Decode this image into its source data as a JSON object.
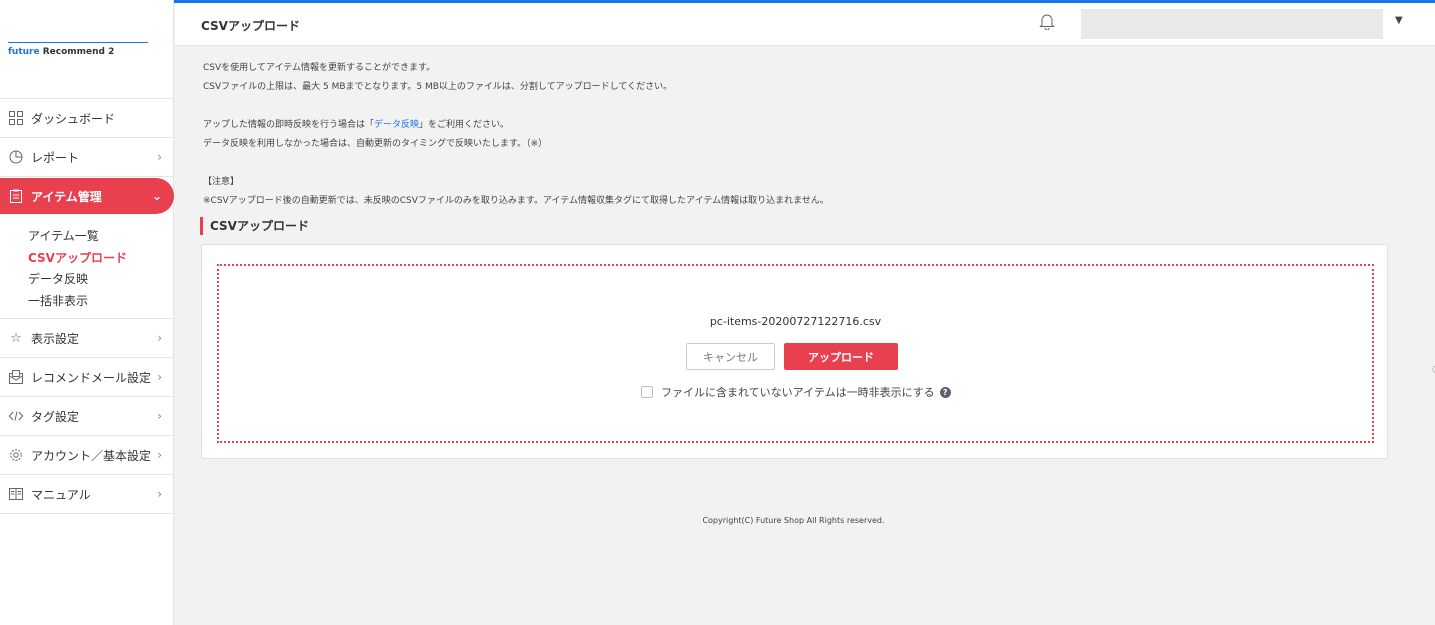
{
  "logo": {
    "brand": "future",
    "product": "Recommend 2"
  },
  "sidebar": {
    "items": [
      {
        "label": "ダッシュボード"
      },
      {
        "label": "レポート"
      },
      {
        "label": "アイテム管理"
      },
      {
        "label": "表示設定"
      },
      {
        "label": "レコメンドメール設定"
      },
      {
        "label": "タグ設定"
      },
      {
        "label": "アカウント／基本設定"
      },
      {
        "label": "マニュアル"
      }
    ],
    "subitems": [
      "アイテム一覧",
      "CSVアップロード",
      "データ反映",
      "一括非表示"
    ]
  },
  "header": {
    "title": "CSVアップロード"
  },
  "description": {
    "line1": "CSVを使用してアイテム情報を更新することができます。",
    "line2": "CSVファイルの上限は、最大 5 MBまでとなります。5 MB以上のファイルは、分割してアップロードしてください。",
    "line3_before": "アップした情報の即時反映を行う場合は「",
    "line3_link": "データ反映",
    "line3_after": "」をご利用ください。",
    "line4": "データ反映を利用しなかった場合は、自動更新のタイミングで反映いたします。（※）",
    "note_title": "【注意】",
    "note_body": "※CSVアップロード後の自動更新では、未反映のCSVファイルのみを取り込みます。アイテム情報収集タグにて取得したアイテム情報は取り込まれません。"
  },
  "section": {
    "title": "CSVアップロード"
  },
  "upload": {
    "filename": "pc-items-20200727122716.csv",
    "cancel_label": "キャンセル",
    "upload_label": "アップロード",
    "checkbox_label": "ファイルに含まれていないアイテムは一時非表示にする",
    "help_glyph": "?"
  },
  "footer": {
    "copyright": "Copyright(C) Future Shop All Rights reserved."
  },
  "colors": {
    "accent": "#e8404f",
    "brand": "#1a73e8"
  }
}
